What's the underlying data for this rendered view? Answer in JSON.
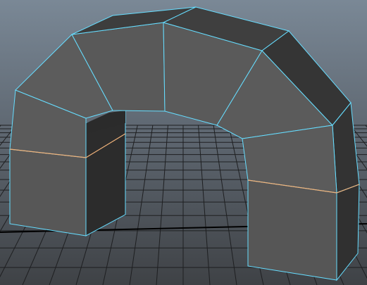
{
  "viewport": {
    "mode": "perspective",
    "background_top": "#7a8896",
    "background_bottom": "#43464a",
    "grid_color": "#1e1f21",
    "grid_axis_color": "#000000"
  },
  "mesh": {
    "object": "arch",
    "segments": 6,
    "edge_color": "#66ddff",
    "selected_loop_color": "#f0b27a",
    "face_color": "#5a5a5a",
    "shadow_face_color": "#3a3a3a",
    "dark_face_color": "#2c2c2c"
  }
}
